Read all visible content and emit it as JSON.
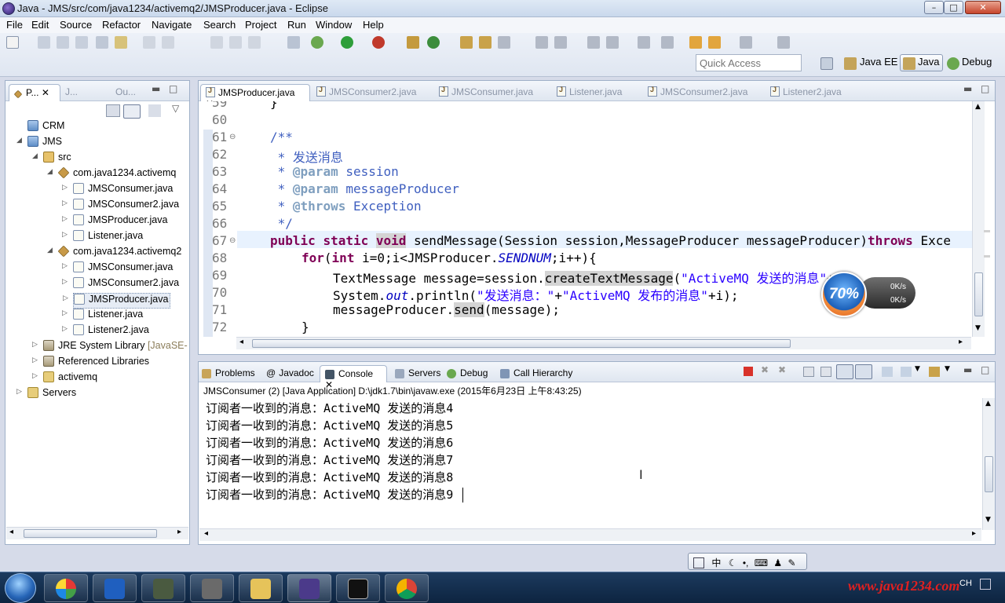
{
  "window": {
    "title": "Java - JMS/src/com/java1234/activemq2/JMSProducer.java - Eclipse",
    "min_glyph": "–",
    "max_glyph": "□",
    "close_glyph": "✕"
  },
  "menu": [
    "File",
    "Edit",
    "Source",
    "Refactor",
    "Navigate",
    "Search",
    "Project",
    "Run",
    "Window",
    "Help"
  ],
  "toolbar": {
    "quick_access_placeholder": "Quick Access",
    "perspectives": [
      "Java EE",
      "Java",
      "Debug"
    ]
  },
  "left_panel": {
    "tabs": [
      "P...",
      "J...",
      "Ou..."
    ],
    "tree": [
      {
        "label": "CRM",
        "icon": "project-icon"
      },
      {
        "label": "JMS",
        "icon": "project-icon"
      },
      {
        "label": "src",
        "icon": "source-folder-icon"
      },
      {
        "label": "com.java1234.activemq",
        "icon": "package-icon"
      },
      {
        "label": "JMSConsumer.java",
        "icon": "java-file-icon"
      },
      {
        "label": "JMSConsumer2.java",
        "icon": "java-file-icon"
      },
      {
        "label": "JMSProducer.java",
        "icon": "java-file-icon"
      },
      {
        "label": "Listener.java",
        "icon": "java-file-icon"
      },
      {
        "label": "com.java1234.activemq2",
        "icon": "package-icon"
      },
      {
        "label": "JMSConsumer.java",
        "icon": "java-file-icon"
      },
      {
        "label": "JMSConsumer2.java",
        "icon": "java-file-icon"
      },
      {
        "label": "JMSProducer.java",
        "icon": "java-file-icon"
      },
      {
        "label": "Listener.java",
        "icon": "java-file-icon"
      },
      {
        "label": "Listener2.java",
        "icon": "java-file-icon"
      },
      {
        "label": "JRE System Library",
        "suffix": "[JavaSE-",
        "icon": "library-icon"
      },
      {
        "label": "Referenced Libraries",
        "icon": "library-icon"
      },
      {
        "label": "activemq",
        "icon": "folder-icon"
      },
      {
        "label": "Servers",
        "icon": "folder-icon"
      }
    ]
  },
  "editor": {
    "tabs": [
      "JMSProducer.java",
      "JMSConsumer2.java",
      "JMSConsumer.java",
      "Listener.java",
      "JMSConsumer2.java",
      "Listener2.java"
    ],
    "line_numbers": [
      "59",
      "60",
      "61",
      "62",
      "63",
      "64",
      "65",
      "66",
      "67",
      "68",
      "69",
      "70",
      "71",
      "72"
    ],
    "lines": {
      "l59": "}",
      "l61": "/**",
      "l62": " * 发送消息",
      "l63_star": " * ",
      "l63_tag": "@param",
      "l63_rest": " session",
      "l64_star": " * ",
      "l64_tag": "@param",
      "l64_rest": " messageProducer",
      "l65_star": " * ",
      "l65_tag": "@throws",
      "l65_rest": " Exception",
      "l66": " */",
      "l67_kw1": "public",
      "l67_kw2": "static",
      "l67_kw3": "void",
      "l67_rest": " sendMessage(Session session,MessageProducer messageProducer)",
      "l67_kw4": "throws",
      "l67_tail": " Exce",
      "l68_kw1": "for",
      "l68_a": "(",
      "l68_kw2": "int",
      "l68_b": " i=0;i<JMSProducer.",
      "l68_fld": "SENDNUM",
      "l68_c": ";i++){",
      "l69_a": "TextMessage message=session.",
      "l69_hl": "createTextMessage",
      "l69_b": "(",
      "l69_str": "\"ActiveMQ 发送的消息\"",
      "l69_c": "+i);",
      "l70_a": "System.",
      "l70_fld": "out",
      "l70_b": ".println(",
      "l70_str1": "\"发送消息：\"",
      "l70_c": "+",
      "l70_str2": "\"ActiveMQ 发布的消息\"",
      "l70_d": "+i);",
      "l71_a": "messageProducer.",
      "l71_hl": "send",
      "l71_b": "(message);",
      "l72": "}"
    }
  },
  "console": {
    "tabs": [
      "Problems",
      "Javadoc",
      "Console",
      "Servers",
      "Debug",
      "Call Hierarchy"
    ],
    "header": "JMSConsumer (2) [Java Application] D:\\jdk1.7\\bin\\javaw.exe (2015年6月23日 上午8:43:25)",
    "lines": [
      "订阅者一收到的消息：ActiveMQ 发送的消息4",
      "订阅者一收到的消息：ActiveMQ 发送的消息5",
      "订阅者一收到的消息：ActiveMQ 发送的消息6",
      "订阅者一收到的消息：ActiveMQ 发送的消息7",
      "订阅者一收到的消息：ActiveMQ 发送的消息8",
      "订阅者一收到的消息：ActiveMQ 发送的消息9"
    ]
  },
  "speed_widget": {
    "percent": "70%",
    "up": "0K/s",
    "down": "0K/s"
  },
  "ime": {
    "label": "中",
    "lang": "CH"
  },
  "watermark": "www.java1234.com",
  "colors": {
    "keyword": "#7f0055",
    "comment": "#3f5fbf",
    "string": "#2a00ff",
    "field": "#0000c0",
    "watermark": "#e02020"
  }
}
